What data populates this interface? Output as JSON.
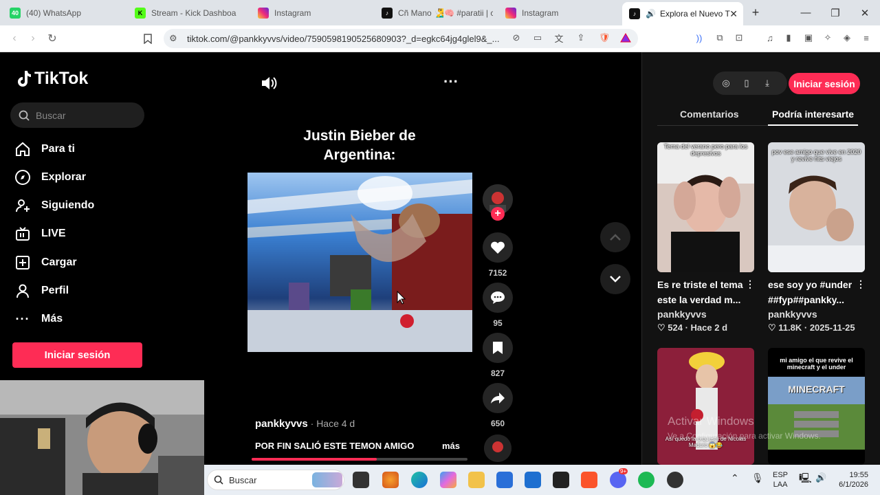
{
  "browser": {
    "tabs": [
      {
        "label": "(40) WhatsApp",
        "favicon": "whatsapp-icon",
        "badge": "40",
        "color": "#25d366"
      },
      {
        "label": "Stream - Kick Dashboa",
        "favicon": "kick-icon",
        "color": "#53fc18"
      },
      {
        "label": "Instagram",
        "favicon": "instagram-icon",
        "color": "#e1306c"
      },
      {
        "label": "Cñ Mano 🧏‍♂️🧠 #paratii | c",
        "favicon": "tiktok-icon",
        "color": "#111111"
      },
      {
        "label": "Instagram",
        "favicon": "instagram-icon",
        "color": "#e1306c"
      },
      {
        "label": "Explora el Nuevo T",
        "favicon": "tiktok-icon",
        "color": "#111111",
        "active": true
      }
    ],
    "new_tab": "+",
    "url": "tiktok.com/@pankkyvvs/video/7590598190525680903?_d=egkc64jg4glel9&_..."
  },
  "tiktok": {
    "logo": "TikTok",
    "search_placeholder": "Buscar",
    "nav": [
      {
        "label": "Para ti",
        "icon": "home-icon"
      },
      {
        "label": "Explorar",
        "icon": "compass-icon"
      },
      {
        "label": "Siguiendo",
        "icon": "following-icon"
      },
      {
        "label": "LIVE",
        "icon": "live-icon"
      },
      {
        "label": "Cargar",
        "icon": "upload-icon"
      },
      {
        "label": "Perfil",
        "icon": "profile-icon"
      },
      {
        "label": "Más",
        "icon": "more-icon"
      }
    ],
    "login": "Iniciar sesión",
    "video": {
      "overlay_title": "Justin Bieber de Argentina:",
      "likes": "7152",
      "comments": "95",
      "saves": "827",
      "shares": "650",
      "author": "pankkyvvs",
      "time": "Hace 4 d",
      "separator": " · ",
      "caption": "POR FIN SALIÓ ESTE TEMON AMIGO",
      "more": "más",
      "progress": 0.58
    },
    "right_panel": {
      "login": "Iniciar sesión",
      "tabs": [
        "Comentarios",
        "Podría interesarte"
      ],
      "active_tab": "Podría interesarte",
      "cards": [
        {
          "overlay": "Tema del verano pero para los depresivos",
          "title": "Es re triste el tema este la verdad m...",
          "user": "pankkyvvs",
          "likes": "524",
          "date": "Hace 2 d"
        },
        {
          "overlay": "pov ese amigo que vive en 2020 y revive hits viejos",
          "title": "ese soy yo #under ##fyp##pankky...",
          "user": "pankkyvvs",
          "likes": "11.8K",
          "date": "2025-11-25"
        },
        {
          "overlay": "Así quedó la orquesta de Nicolás Maduro 😱😂"
        },
        {
          "overlay": "mi amigo el que revive el minecraft y el under",
          "inner": "MINECRAFT"
        }
      ]
    }
  },
  "windows": {
    "watermark": "Activar Windows",
    "watermark_sub": "Ve a Configuración para activar Windows.",
    "search_placeholder": "Buscar",
    "notif_badge": "9+",
    "lang": "ESP",
    "lang2": "LAA",
    "time": "19:55",
    "date": "6/1/2026"
  }
}
